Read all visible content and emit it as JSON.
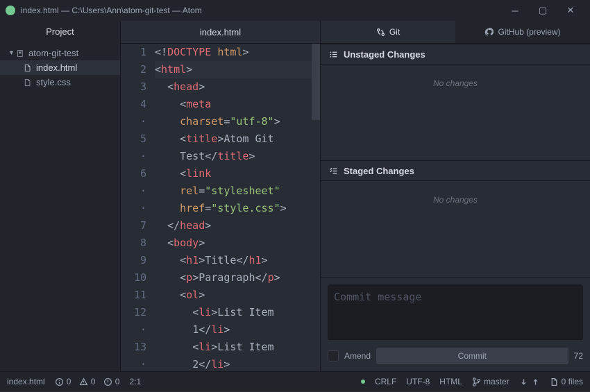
{
  "titlebar": {
    "title": "index.html — C:\\Users\\Ann\\atom-git-test — Atom"
  },
  "sidebar": {
    "header": "Project",
    "root": "atom-git-test",
    "files": [
      {
        "name": "index.html",
        "active": true
      },
      {
        "name": "style.css",
        "active": false
      }
    ]
  },
  "editor": {
    "tab": "index.html",
    "cursor_line": 2,
    "lines": [
      {
        "n": "1",
        "html": "<span class='p'>&lt;!</span><span class='t'>DOCTYPE</span> <span class='a'>html</span><span class='p'>&gt;</span>"
      },
      {
        "n": "2",
        "html": "<span class='p'>&lt;</span><span class='t'>html</span><span class='p'>&gt;</span>"
      },
      {
        "n": "3",
        "html": "  <span class='p'>&lt;</span><span class='t'>head</span><span class='p'>&gt;</span>"
      },
      {
        "n": "4",
        "html": "    <span class='p'>&lt;</span><span class='t'>meta</span>"
      },
      {
        "n": "·",
        "html": "    <span class='a'>charset</span><span class='p'>=</span><span class='s'>\"utf-8\"</span><span class='p'>&gt;</span>"
      },
      {
        "n": "5",
        "html": "    <span class='p'>&lt;</span><span class='t'>title</span><span class='p'>&gt;Atom Git</span>"
      },
      {
        "n": "·",
        "html": "    <span class='p'>Test&lt;/</span><span class='t'>title</span><span class='p'>&gt;</span>"
      },
      {
        "n": "6",
        "html": "    <span class='p'>&lt;</span><span class='t'>link</span>"
      },
      {
        "n": "·",
        "html": "    <span class='a'>rel</span><span class='p'>=</span><span class='s'>\"stylesheet\"</span>"
      },
      {
        "n": "·",
        "html": "    <span class='a'>href</span><span class='p'>=</span><span class='s'>\"style.css\"</span><span class='p'>&gt;</span>"
      },
      {
        "n": "7",
        "html": "  <span class='p'>&lt;/</span><span class='t'>head</span><span class='p'>&gt;</span>"
      },
      {
        "n": "8",
        "html": "  <span class='p'>&lt;</span><span class='t'>body</span><span class='p'>&gt;</span>"
      },
      {
        "n": "9",
        "html": "    <span class='p'>&lt;</span><span class='t'>h1</span><span class='p'>&gt;Title&lt;/</span><span class='t'>h1</span><span class='p'>&gt;</span>"
      },
      {
        "n": "10",
        "html": "    <span class='p'>&lt;</span><span class='t'>p</span><span class='p'>&gt;Paragraph&lt;/</span><span class='t'>p</span><span class='p'>&gt;</span>"
      },
      {
        "n": "11",
        "html": "    <span class='p'>&lt;</span><span class='t'>ol</span><span class='p'>&gt;</span>"
      },
      {
        "n": "12",
        "html": "      <span class='p'>&lt;</span><span class='t'>li</span><span class='p'>&gt;List Item</span>"
      },
      {
        "n": "·",
        "html": "      <span class='p'>1&lt;/</span><span class='t'>li</span><span class='p'>&gt;</span>"
      },
      {
        "n": "13",
        "html": "      <span class='p'>&lt;</span><span class='t'>li</span><span class='p'>&gt;List Item</span>"
      },
      {
        "n": "·",
        "html": "      <span class='p'>2&lt;/</span><span class='t'>li</span><span class='p'>&gt;</span>"
      }
    ]
  },
  "git": {
    "tab_git": "Git",
    "tab_github": "GitHub (preview)",
    "unstaged_header": "Unstaged Changes",
    "staged_header": "Staged Changes",
    "no_changes": "No changes",
    "commit_placeholder": "Commit message",
    "amend_label": "Amend",
    "commit_button": "Commit",
    "remaining": "72"
  },
  "status": {
    "file": "index.html",
    "diag_i": "0",
    "diag_w": "0",
    "diag_e": "0",
    "cursor": "2:1",
    "line_ending": "CRLF",
    "encoding": "UTF-8",
    "lang": "HTML",
    "branch": "master",
    "files": "0 files"
  }
}
